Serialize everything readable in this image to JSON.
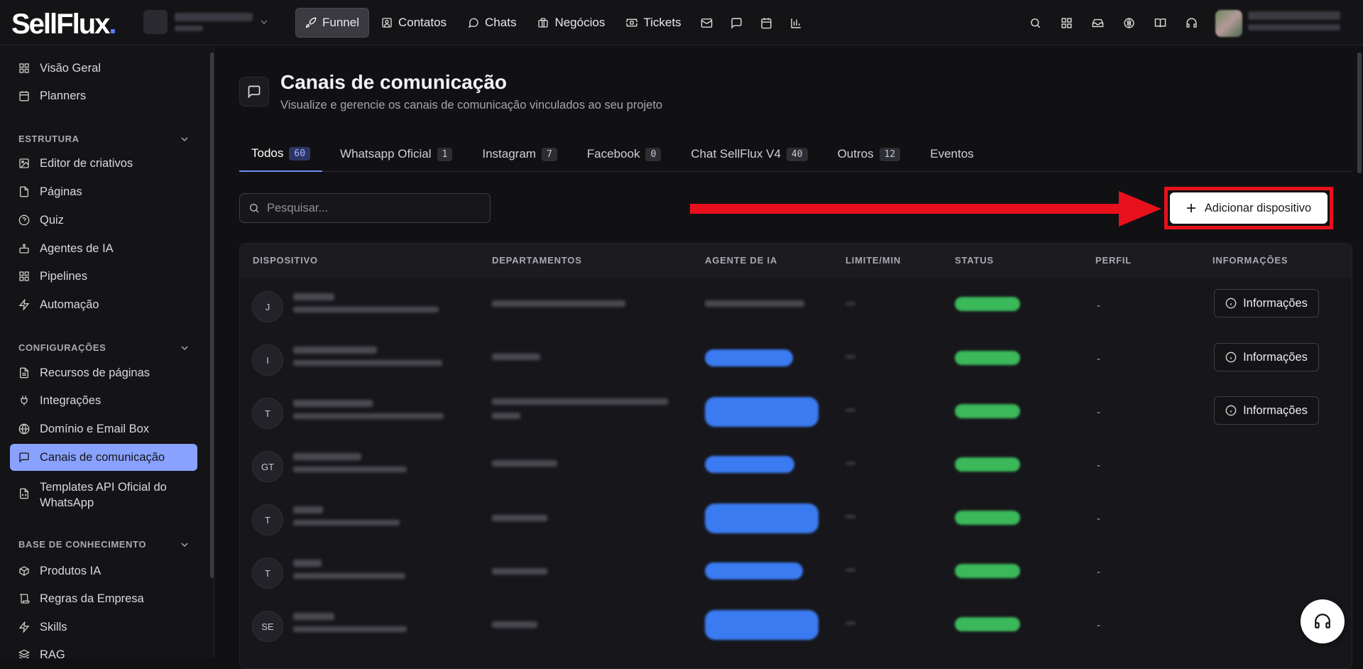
{
  "app": {
    "logo_text": "SellFlux",
    "logo_dot": "."
  },
  "topnav": {
    "items": [
      {
        "label": "Funnel",
        "icon": "rocket-icon",
        "active": true
      },
      {
        "label": "Contatos",
        "icon": "contacts-icon"
      },
      {
        "label": "Chats",
        "icon": "chat-icon"
      },
      {
        "label": "Negócios",
        "icon": "briefcase-icon"
      },
      {
        "label": "Tickets",
        "icon": "ticket-icon"
      }
    ],
    "icon_only": [
      "mail-icon",
      "message-icon",
      "calendar-icon",
      "bar-chart-icon"
    ],
    "right_icons": [
      "search-icon",
      "apps-icon",
      "inbox-icon",
      "brain-icon",
      "book-icon",
      "headset-icon"
    ]
  },
  "sidebar": {
    "top_items": [
      {
        "label": "Visão Geral",
        "icon": "grid-icon"
      },
      {
        "label": "Planners",
        "icon": "calendar-icon"
      }
    ],
    "sections": [
      {
        "title": "ESTRUTURA",
        "items": [
          {
            "label": "Editor de criativos",
            "icon": "image-edit-icon"
          },
          {
            "label": "Páginas",
            "icon": "file-icon"
          },
          {
            "label": "Quiz",
            "icon": "help-circle-icon"
          },
          {
            "label": "Agentes de IA",
            "icon": "bot-icon"
          },
          {
            "label": "Pipelines",
            "icon": "grid-icon"
          },
          {
            "label": "Automação",
            "icon": "zap-icon"
          }
        ]
      },
      {
        "title": "CONFIGURAÇÕES",
        "items": [
          {
            "label": "Recursos de páginas",
            "icon": "file-text-icon"
          },
          {
            "label": "Integrações",
            "icon": "plug-icon"
          },
          {
            "label": "Domínio e Email Box",
            "icon": "globe-icon"
          },
          {
            "label": "Canais de comunicação",
            "icon": "message-square-icon",
            "active": true
          },
          {
            "label": "Templates API Oficial do WhatsApp",
            "icon": "file-code-icon"
          }
        ]
      },
      {
        "title": "BASE DE CONHECIMENTO",
        "items": [
          {
            "label": "Produtos IA",
            "icon": "package-icon"
          },
          {
            "label": "Regras da Empresa",
            "icon": "scroll-icon"
          },
          {
            "label": "Skills",
            "icon": "zap-icon"
          },
          {
            "label": "RAG",
            "icon": "layers-icon"
          }
        ]
      }
    ]
  },
  "page": {
    "title": "Canais de comunicação",
    "subtitle": "Visualize e gerencie os canais de comunicação vinculados ao seu projeto"
  },
  "tabs": [
    {
      "label": "Todos",
      "count": "60",
      "active": true
    },
    {
      "label": "Whatsapp Oficial",
      "count": "1"
    },
    {
      "label": "Instagram",
      "count": "7"
    },
    {
      "label": "Facebook",
      "count": "0"
    },
    {
      "label": "Chat SellFlux V4",
      "count": "40"
    },
    {
      "label": "Outros",
      "count": "12"
    },
    {
      "label": "Eventos",
      "count": ""
    }
  ],
  "search": {
    "placeholder": "Pesquisar..."
  },
  "add_button": {
    "label": "Adicionar dispositivo"
  },
  "table": {
    "headers": [
      "DISPOSITIVO",
      "DEPARTAMENTOS",
      "AGENTE DE IA",
      "LIMITE/MIN",
      "STATUS",
      "PERFIL",
      "INFORMAÇÕES"
    ],
    "rows": [
      {
        "initials": "J",
        "perfil": "-",
        "info": "Informações"
      },
      {
        "initials": "I",
        "perfil": "-",
        "info": "Informações"
      },
      {
        "initials": "T",
        "perfil": "-",
        "info": "Informações"
      },
      {
        "initials": "GT",
        "perfil": "-",
        "info": ""
      },
      {
        "initials": "T",
        "perfil": "-",
        "info": ""
      },
      {
        "initials": "T",
        "perfil": "-",
        "info": ""
      },
      {
        "initials": "SE",
        "perfil": "-",
        "info": ""
      }
    ]
  },
  "colors": {
    "accent": "#8aa2ff",
    "highlight": "#e8101c",
    "status": "#3bb85a",
    "agent": "#3a7bf2"
  }
}
